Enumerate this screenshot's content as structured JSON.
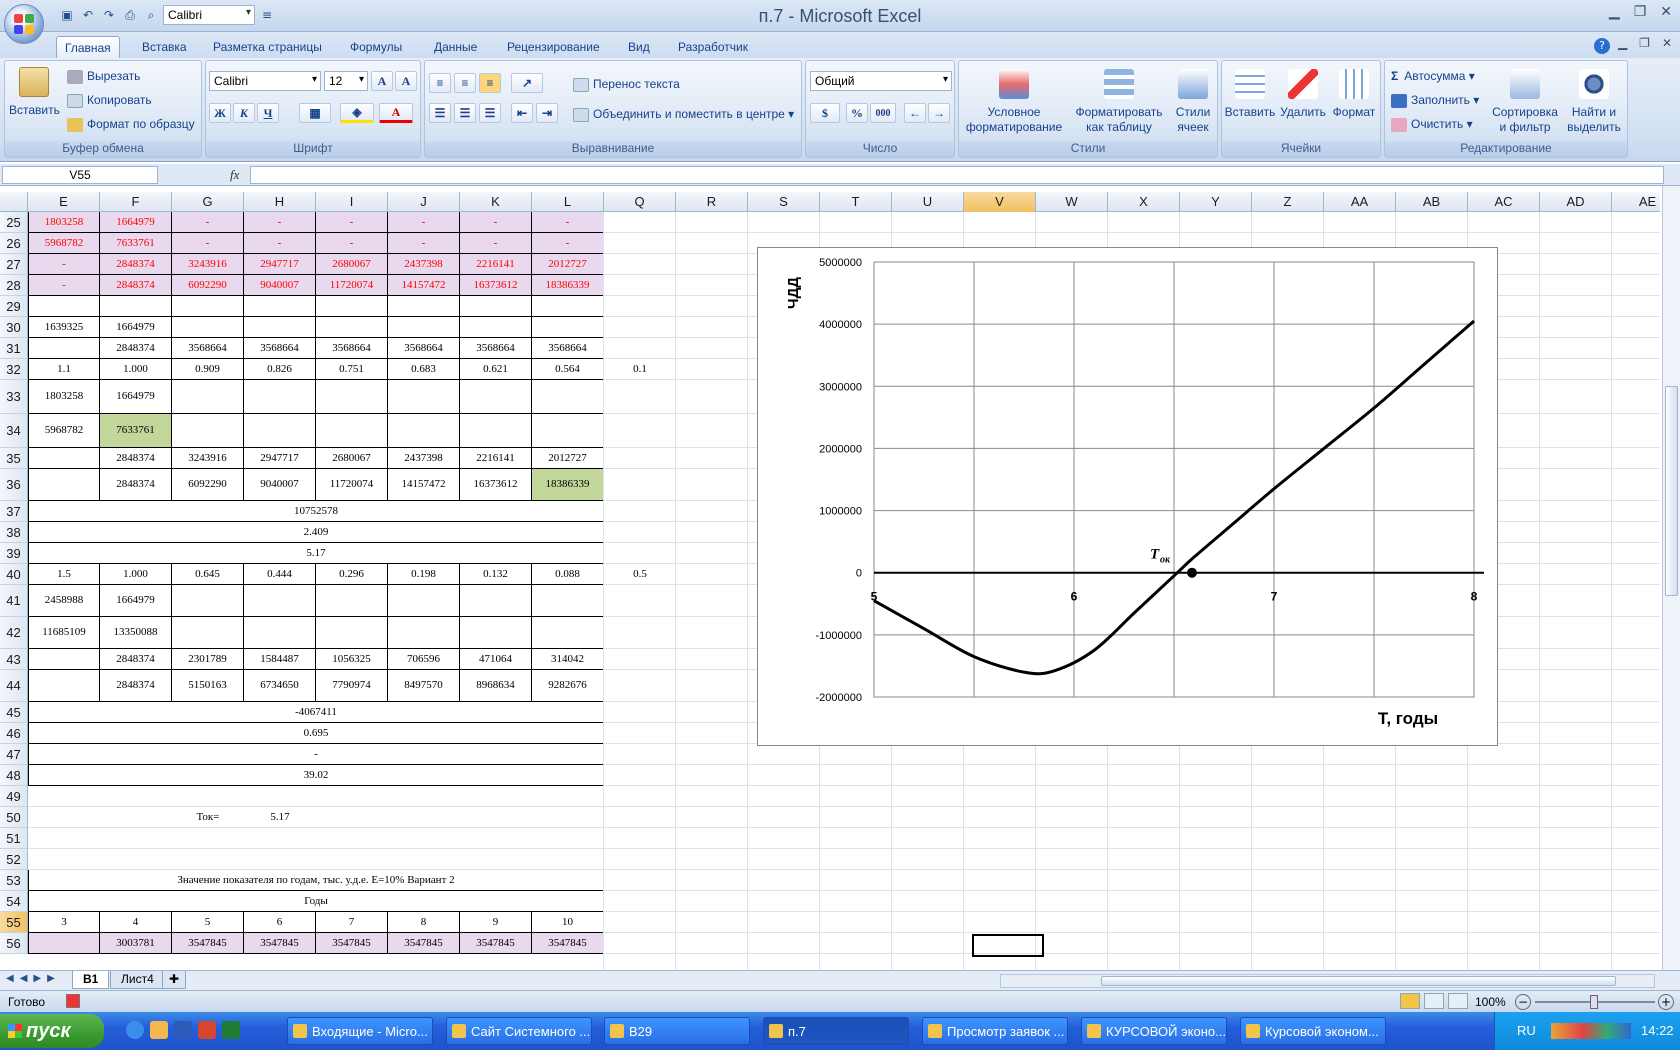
{
  "window": {
    "title": "п.7 - Microsoft Excel"
  },
  "qat": {
    "font": "Calibri"
  },
  "tabs": [
    "Главная",
    "Вставка",
    "Разметка страницы",
    "Формулы",
    "Данные",
    "Рецензирование",
    "Вид",
    "Разработчик"
  ],
  "ribbon": {
    "clipboard": {
      "paste": "Вставить",
      "cut": "Вырезать",
      "copy": "Копировать",
      "format_painter": "Формат по образцу",
      "label": "Буфер обмена"
    },
    "font": {
      "name": "Calibri",
      "size": "12",
      "label": "Шрифт",
      "bold": "Ж",
      "italic": "К",
      "underline": "Ч"
    },
    "alignment": {
      "wrap": "Перенос текста",
      "merge": "Объединить и поместить в центре",
      "label": "Выравнивание"
    },
    "number": {
      "format": "Общий",
      "percent": "%",
      "thousands": "000",
      "label": "Число"
    },
    "styles": {
      "conditional": "Условное форматирование",
      "as_table": "Форматировать как таблицу",
      "cell_styles": "Стили ячеек",
      "label": "Стили"
    },
    "cells": {
      "insert": "Вставить",
      "delete": "Удалить",
      "format": "Формат",
      "label": "Ячейки"
    },
    "editing": {
      "autosum": "Автосумма",
      "fill": "Заполнить",
      "clear": "Очистить",
      "sort": "Сортировка и фильтр",
      "find": "Найти и выделить",
      "label": "Редактирование"
    }
  },
  "formula_bar": {
    "name_box": "V55",
    "fx": "fx",
    "value": ""
  },
  "columns": [
    "E",
    "F",
    "G",
    "H",
    "I",
    "J",
    "K",
    "L",
    "Q",
    "R",
    "S",
    "T",
    "U",
    "V",
    "W",
    "X",
    "Y",
    "Z",
    "AA",
    "AB",
    "AC",
    "AD",
    "AE"
  ],
  "rows": [
    {
      "n": "25",
      "cells": [
        "1803258",
        "1664979",
        "-",
        "-",
        "-",
        "-",
        "-",
        "-"
      ],
      "style": "red"
    },
    {
      "n": "26",
      "cells": [
        "5968782",
        "7633761",
        "-",
        "-",
        "-",
        "-",
        "-",
        "-"
      ],
      "style": "red"
    },
    {
      "n": "27",
      "cells": [
        "-",
        "2848374",
        "3243916",
        "2947717",
        "2680067",
        "2437398",
        "2216141",
        "2012727"
      ],
      "style": "red"
    },
    {
      "n": "28",
      "cells": [
        "-",
        "2848374",
        "6092290",
        "9040007",
        "11720074",
        "14157472",
        "16373612",
        "18386339"
      ],
      "style": "red"
    },
    {
      "n": "29",
      "cells": [
        "",
        "",
        "",
        "",
        "",
        "",
        "",
        ""
      ]
    },
    {
      "n": "30",
      "cells": [
        "1639325",
        "1664979",
        "",
        "",
        "",
        "",
        "",
        ""
      ]
    },
    {
      "n": "31",
      "cells": [
        "",
        "2848374",
        "3568664",
        "3568664",
        "3568664",
        "3568664",
        "3568664",
        "3568664"
      ]
    },
    {
      "n": "32",
      "cells": [
        "1.1",
        "1.000",
        "0.909",
        "0.826",
        "0.751",
        "0.683",
        "0.621",
        "0.564"
      ],
      "q": "0.1"
    },
    {
      "n": "33",
      "cells": [
        "1803258",
        "1664979",
        "",
        "",
        "",
        "",
        "",
        ""
      ]
    },
    {
      "n": "34",
      "cells": [
        "5968782",
        "7633761",
        "",
        "",
        "",
        "",
        "",
        ""
      ]
    },
    {
      "n": "35",
      "cells": [
        "",
        "2848374",
        "3243916",
        "2947717",
        "2680067",
        "2437398",
        "2216141",
        "2012727"
      ]
    },
    {
      "n": "36",
      "cells": [
        "",
        "2848374",
        "6092290",
        "9040007",
        "11720074",
        "14157472",
        "16373612",
        "18386339"
      ]
    },
    {
      "n": "37",
      "merged": "10752578"
    },
    {
      "n": "38",
      "merged": "2.409"
    },
    {
      "n": "39",
      "merged": "5.17"
    },
    {
      "n": "40",
      "cells": [
        "1.5",
        "1.000",
        "0.645",
        "0.444",
        "0.296",
        "0.198",
        "0.132",
        "0.088"
      ],
      "q": "0.5"
    },
    {
      "n": "41",
      "cells": [
        "2458988",
        "1664979",
        "",
        "",
        "",
        "",
        "",
        ""
      ]
    },
    {
      "n": "42",
      "cells": [
        "11685109",
        "13350088",
        "",
        "",
        "",
        "",
        "",
        ""
      ]
    },
    {
      "n": "43",
      "cells": [
        "",
        "2848374",
        "2301789",
        "1584487",
        "1056325",
        "706596",
        "471064",
        "314042"
      ]
    },
    {
      "n": "44",
      "cells": [
        "",
        "2848374",
        "5150163",
        "6734650",
        "7790974",
        "8497570",
        "8968634",
        "9282676"
      ]
    },
    {
      "n": "45",
      "merged": "-4067411"
    },
    {
      "n": "46",
      "merged": "0.695"
    },
    {
      "n": "47",
      "merged": "-"
    },
    {
      "n": "48",
      "merged": "39.02"
    },
    {
      "n": "50",
      "tok_label": "Ток=",
      "tok_value": "5.17"
    },
    {
      "n": "51"
    },
    {
      "n": "52"
    },
    {
      "n": "53",
      "merged": "Значение показателя по годам, тыс. у.д.е.        Е=10%       Вариант 2"
    },
    {
      "n": "54",
      "merged": "Годы"
    },
    {
      "n": "55",
      "cells": [
        "3",
        "4",
        "5",
        "6",
        "7",
        "8",
        "9",
        "10"
      ]
    }
  ],
  "row56_partial": [
    "",
    "3003781",
    "3547845",
    "3547845",
    "3547845",
    "3547845",
    "3547845",
    "3547845"
  ],
  "chart_data": {
    "type": "line",
    "title": "",
    "xlabel": "T, годы",
    "ylabel": "ЧДД",
    "xlim": [
      5,
      8
    ],
    "ylim": [
      -2000000,
      5000000
    ],
    "xticks": [
      "5",
      "6",
      "7",
      "8"
    ],
    "yticks": [
      "5000000",
      "4000000",
      "3000000",
      "2000000",
      "1000000",
      "0",
      "-1000000",
      "-2000000"
    ],
    "annotation": "T",
    "annotation_sub": "ок",
    "x": [
      5.0,
      5.25,
      5.5,
      5.75,
      5.9,
      6.1,
      6.3,
      6.5,
      6.6,
      6.8,
      7.0,
      7.25,
      7.5,
      7.75,
      8.0
    ],
    "y": [
      -450000,
      -900000,
      -1350000,
      -1600000,
      -1580000,
      -1250000,
      -650000,
      -50000,
      250000,
      800000,
      1350000,
      2000000,
      2650000,
      3350000,
      4050000
    ],
    "marker": {
      "x": 6.59,
      "y": 0
    },
    "grid": true
  },
  "sheet_tabs": [
    "В1",
    "Лист4"
  ],
  "status": {
    "ready": "Готово",
    "zoom": "100%"
  },
  "taskbar": {
    "start": "пуск",
    "items": [
      "Входящие - Micro...",
      "Сайт Системного ...",
      "B29",
      "п.7",
      "Просмотр заявок ...",
      "КУРСОВОЙ эконо...",
      "Курсовой эконом..."
    ],
    "lang": "RU",
    "time": "14:22"
  }
}
